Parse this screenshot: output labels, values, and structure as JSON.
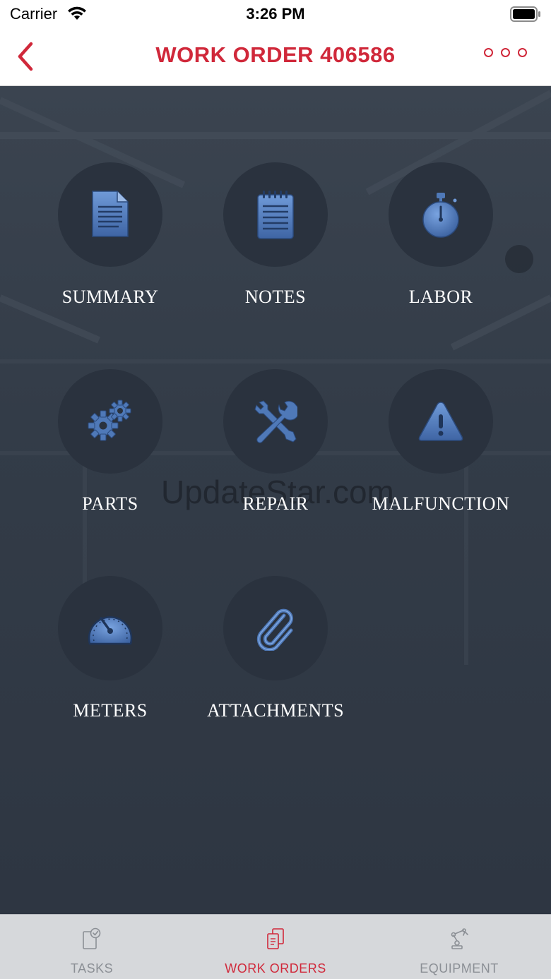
{
  "status_bar": {
    "carrier": "Carrier",
    "time": "3:26 PM"
  },
  "nav": {
    "title": "WORK ORDER 406586"
  },
  "tiles": [
    {
      "label": "SUMMARY",
      "icon": "document-icon"
    },
    {
      "label": "NOTES",
      "icon": "notepad-icon"
    },
    {
      "label": "LABOR",
      "icon": "stopwatch-icon"
    },
    {
      "label": "PARTS",
      "icon": "gears-icon"
    },
    {
      "label": "REPAIR",
      "icon": "tools-icon"
    },
    {
      "label": "MALFUNCTION",
      "icon": "warning-icon"
    },
    {
      "label": "METERS",
      "icon": "gauge-icon"
    },
    {
      "label": "ATTACHMENTS",
      "icon": "paperclip-icon"
    }
  ],
  "watermark": "UpdateStar.com",
  "tab_bar": {
    "tabs": [
      {
        "label": "TASKS",
        "icon": "tasks-icon",
        "active": false
      },
      {
        "label": "WORK ORDERS",
        "icon": "work-orders-icon",
        "active": true
      },
      {
        "label": "EQUIPMENT",
        "icon": "robot-arm-icon",
        "active": false
      }
    ]
  },
  "colors": {
    "accent": "#d0283a",
    "icon_blue": "#4f79b8",
    "tile_circle": "#2a323e",
    "background": "#333c48",
    "tab_bar": "#d6d8db",
    "tab_inactive": "#8b8f95"
  }
}
